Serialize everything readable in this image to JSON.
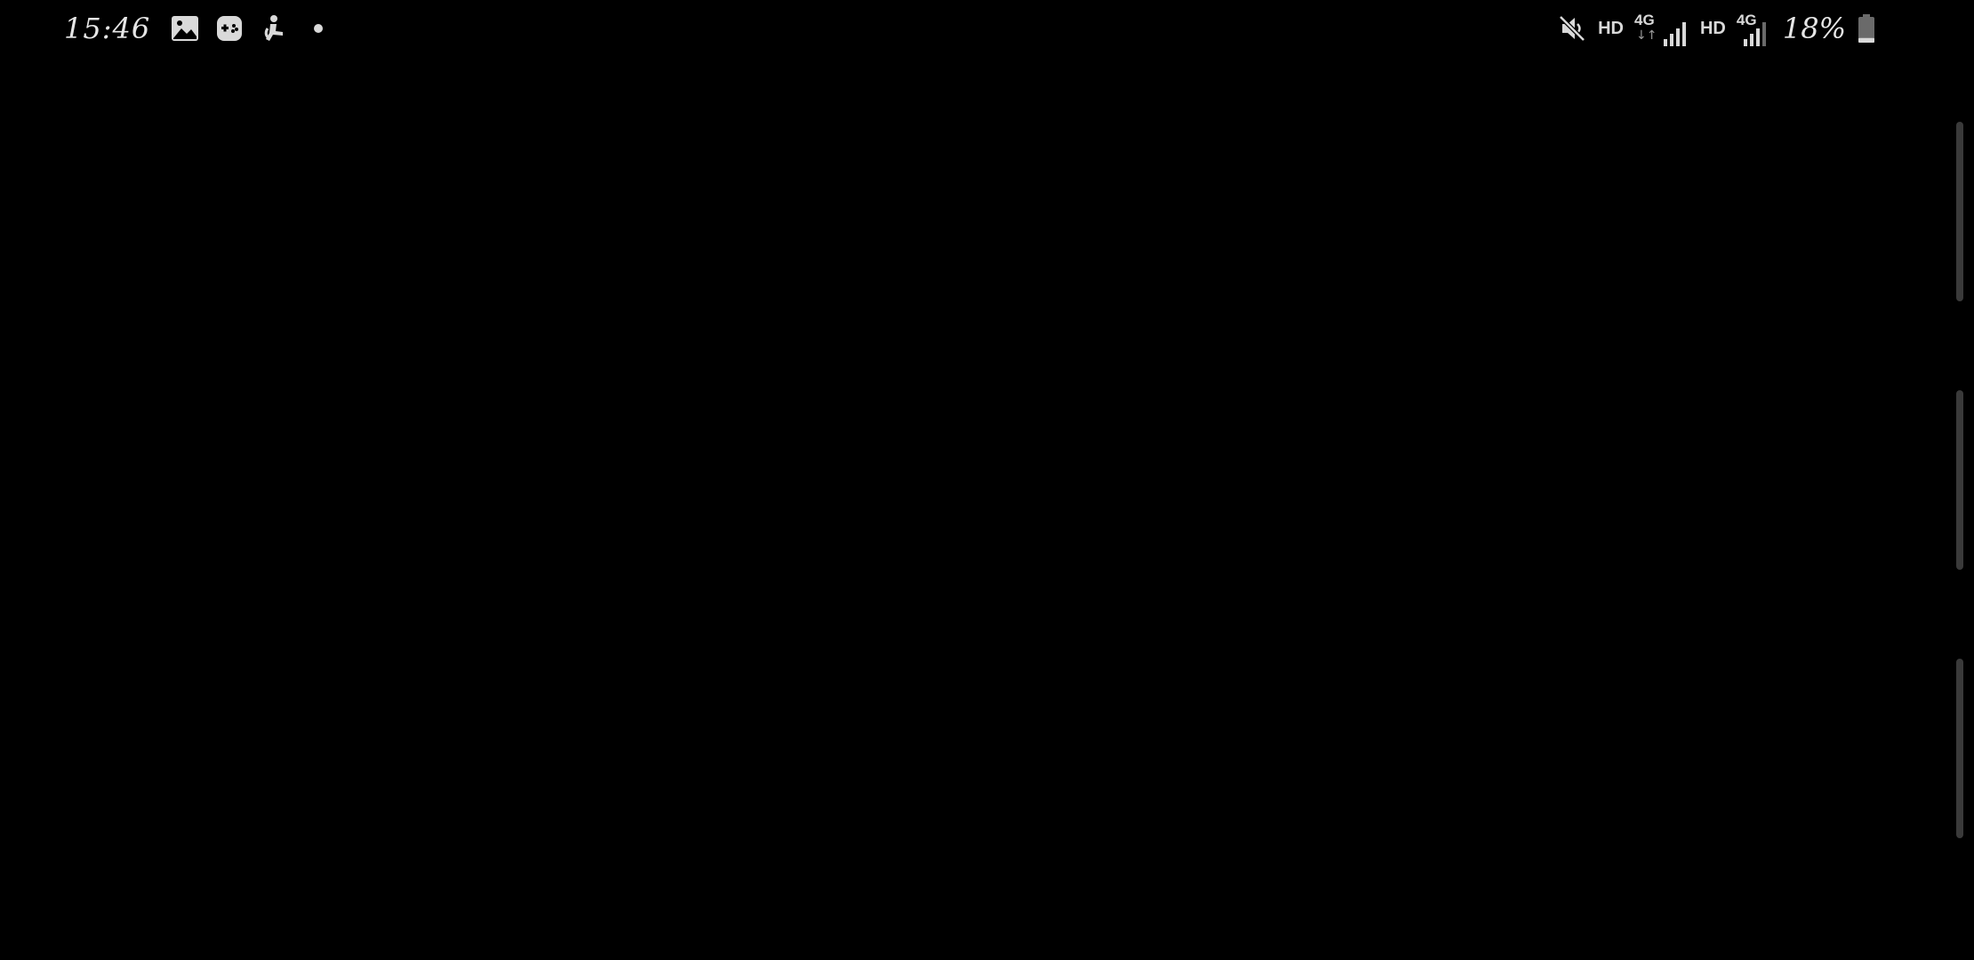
{
  "status_bar": {
    "time": "15:46",
    "notifications": [
      "gallery-icon",
      "game-controller-icon",
      "accessibility-person-icon",
      "dot-indicator"
    ],
    "mute_icon": "muted-speaker-icon",
    "sim1": {
      "hd": "HD",
      "network": "4G",
      "arrows": "↓↑",
      "signal_bars": 4
    },
    "sim2": {
      "hd": "HD",
      "network": "4G",
      "signal_bars": 3
    },
    "battery": {
      "percent_text": "18%",
      "level": 0.18
    }
  },
  "edge_panel": {
    "handles": 3,
    "color": "#3a3a3a"
  },
  "colors": {
    "background": "#000000",
    "icon": "#d9d9d9",
    "muted_bar": "#6a6a6a"
  }
}
